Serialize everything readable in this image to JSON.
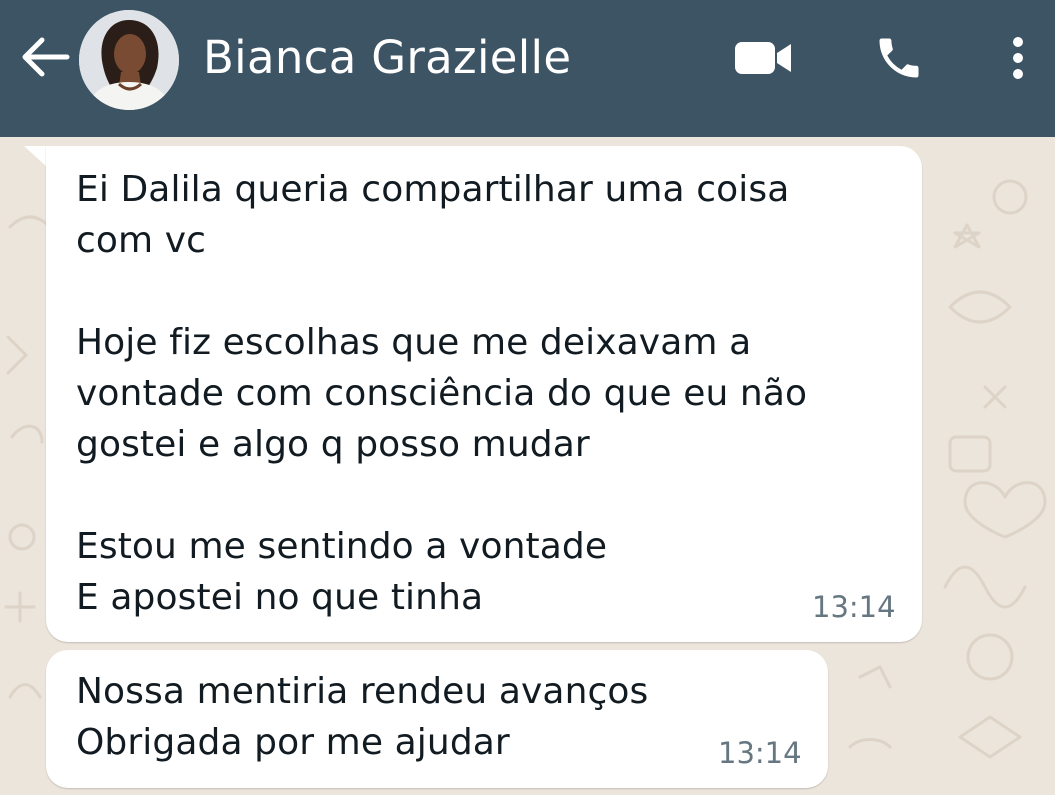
{
  "header": {
    "back_icon": "arrow-left-icon",
    "contact_name": "Bianca Grazielle",
    "video_icon": "video-camera-icon",
    "call_icon": "phone-icon",
    "menu_icon": "more-vertical-icon",
    "background_color": "#3d5464"
  },
  "messages": [
    {
      "lines": [
        "Ei Dalila queria compartilhar uma coisa",
        "com vc",
        "Hoje fiz escolhas que me deixavam a",
        "vontade com consciência do que eu não",
        "gostei e algo q posso mudar",
        "Estou me sentindo a vontade",
        "E apostei no que tinha"
      ],
      "time": "13:14"
    },
    {
      "lines": [
        "Nossa mentiria rendeu avanços",
        "Obrigada por me ajudar"
      ],
      "time": "13:14"
    }
  ],
  "colors": {
    "bubble": "#ffffff",
    "timestamp": "#667781",
    "wallpaper": "#ece5dc"
  }
}
